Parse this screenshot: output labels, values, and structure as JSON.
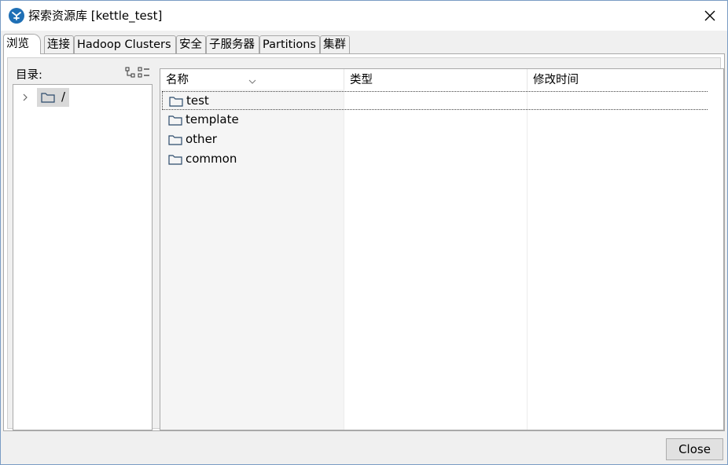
{
  "window": {
    "title": "探索资源库 [kettle_test]"
  },
  "tabs": [
    {
      "label": "浏览",
      "active": true
    },
    {
      "label": "连接"
    },
    {
      "label": "Hadoop Clusters"
    },
    {
      "label": "安全"
    },
    {
      "label": "子服务器"
    },
    {
      "label": "Partitions"
    },
    {
      "label": "集群"
    }
  ],
  "browse": {
    "directory_label": "目录:",
    "tree": {
      "root_label": "/"
    },
    "columns": {
      "name": "名称",
      "type": "类型",
      "modified": "修改时间"
    },
    "rows": [
      {
        "name": "test",
        "selected": true
      },
      {
        "name": "template"
      },
      {
        "name": "other"
      },
      {
        "name": "common"
      }
    ]
  },
  "footer": {
    "close_label": "Close"
  },
  "colors": {
    "tab_border": "#a9a9a9",
    "app_icon": "#1f6fb5",
    "tree_selection": "#d9d9d9",
    "button_face": "#e1e1e1"
  },
  "icons": {
    "app": "kettle-app-icon",
    "close": "close-icon",
    "folder": "folder-icon",
    "expander": "chevron-right-icon",
    "view_toggle": "tree-list-view-icon",
    "sort": "chevron-down-icon"
  }
}
